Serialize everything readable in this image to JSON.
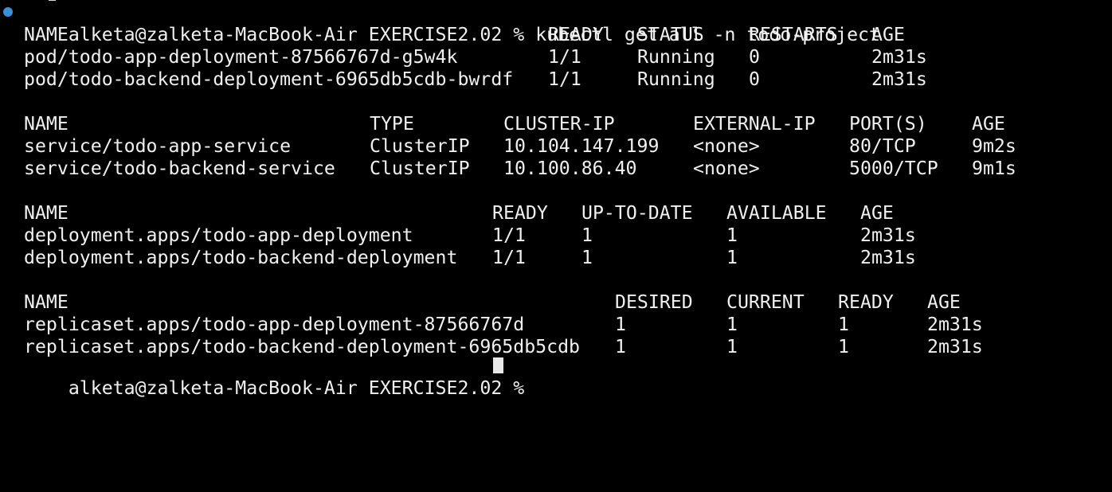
{
  "terminal": {
    "prompt": {
      "user_host": "alketa@zalketa-MacBook-Air",
      "cwd": "EXERCISE2.02",
      "symbol": "%",
      "command": "kubectl get all -n todo-project",
      "status_color": "#3a8fd6"
    },
    "pods": {
      "headers": [
        "NAME",
        "READY",
        "STATUS",
        "RESTARTS",
        "AGE"
      ],
      "rows": [
        [
          "pod/todo-app-deployment-87566767d-g5w4k",
          "1/1",
          "Running",
          "0",
          "2m31s"
        ],
        [
          "pod/todo-backend-deployment-6965db5cdb-bwrdf",
          "1/1",
          "Running",
          "0",
          "2m31s"
        ]
      ]
    },
    "services": {
      "headers": [
        "NAME",
        "TYPE",
        "CLUSTER-IP",
        "EXTERNAL-IP",
        "PORT(S)",
        "AGE"
      ],
      "rows": [
        [
          "service/todo-app-service",
          "ClusterIP",
          "10.104.147.199",
          "<none>",
          "80/TCP",
          "9m2s"
        ],
        [
          "service/todo-backend-service",
          "ClusterIP",
          "10.100.86.40",
          "<none>",
          "5000/TCP",
          "9m1s"
        ]
      ]
    },
    "deployments": {
      "headers": [
        "NAME",
        "READY",
        "UP-TO-DATE",
        "AVAILABLE",
        "AGE"
      ],
      "rows": [
        [
          "deployment.apps/todo-app-deployment",
          "1/1",
          "1",
          "1",
          "2m31s"
        ],
        [
          "deployment.apps/todo-backend-deployment",
          "1/1",
          "1",
          "1",
          "2m31s"
        ]
      ]
    },
    "replicasets": {
      "headers": [
        "NAME",
        "DESIRED",
        "CURRENT",
        "READY",
        "AGE"
      ],
      "rows": [
        [
          "replicaset.apps/todo-app-deployment-87566767d",
          "1",
          "1",
          "1",
          "2m31s"
        ],
        [
          "replicaset.apps/todo-backend-deployment-6965db5cdb",
          "1",
          "1",
          "1",
          "2m31s"
        ]
      ]
    },
    "next_prompt": "alketa@zalketa-MacBook-Air EXERCISE2.02 %"
  }
}
